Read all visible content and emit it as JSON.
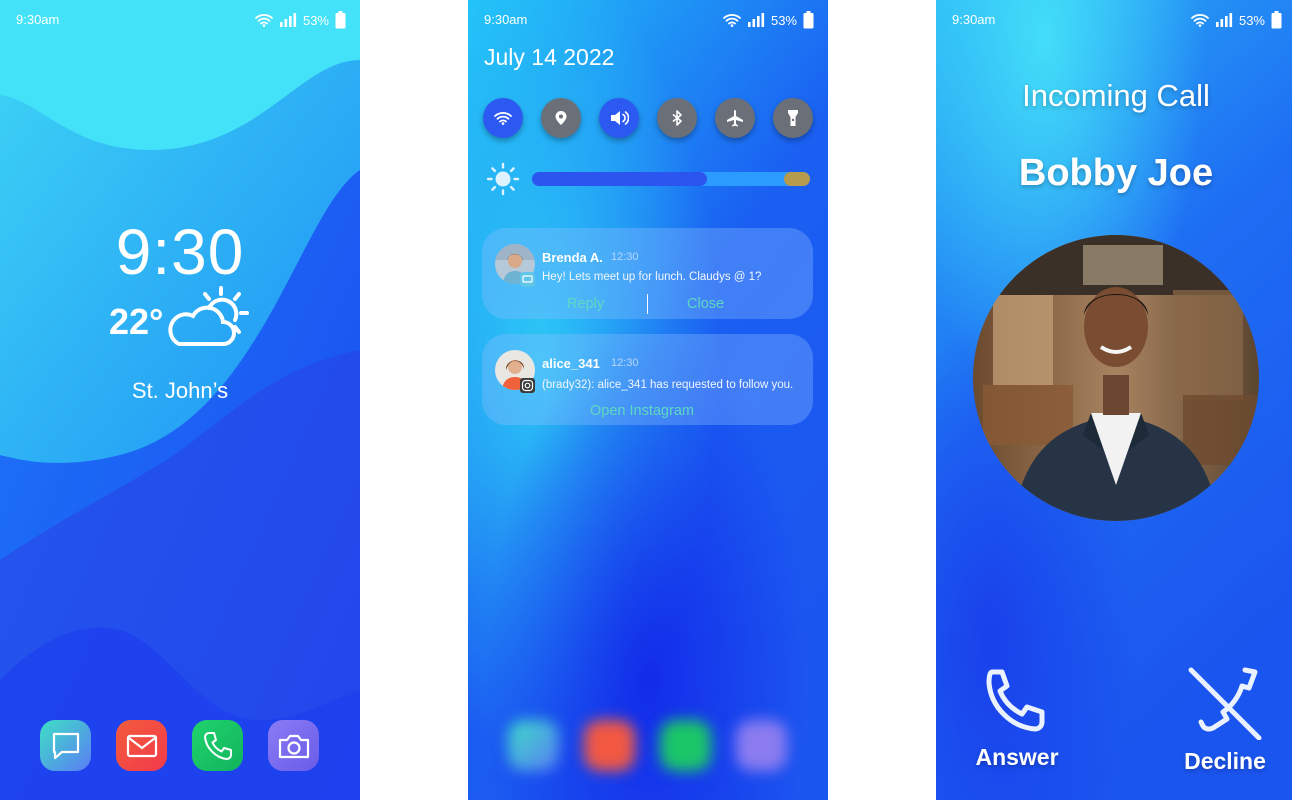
{
  "status_bar": {
    "time": "9:30am",
    "battery": "53%"
  },
  "lock_screen": {
    "clock": "9:30",
    "temperature": "22°",
    "weather_icon": "partly-sunny-icon",
    "city": "St. John’s",
    "dock": [
      {
        "name": "messages",
        "icon": "message-icon"
      },
      {
        "name": "email",
        "icon": "mail-icon"
      },
      {
        "name": "phone",
        "icon": "phone-icon"
      },
      {
        "name": "camera",
        "icon": "camera-icon"
      }
    ]
  },
  "notification_shade": {
    "date": "July 14 2022",
    "quick_settings": [
      {
        "name": "wifi",
        "icon": "wifi-icon",
        "on": true
      },
      {
        "name": "location",
        "icon": "location-pin-icon",
        "on": false
      },
      {
        "name": "sound",
        "icon": "volume-icon",
        "on": true
      },
      {
        "name": "bluetooth",
        "icon": "bluetooth-icon",
        "on": false
      },
      {
        "name": "airplane-mode",
        "icon": "airplane-icon",
        "on": false
      },
      {
        "name": "flashlight",
        "icon": "flashlight-icon",
        "on": false
      }
    ],
    "brightness": {
      "icon": "sun-icon",
      "level": 0.63
    },
    "notifications": [
      {
        "sender": "Brenda A.",
        "time": "12:30",
        "message": "Hey! Lets meet up for lunch. Claudys @ 1?",
        "app_icon": "messages-badge-icon",
        "actions": [
          "Reply",
          "Close"
        ]
      },
      {
        "sender": "alice_341",
        "time": "12:30",
        "message": "(brady32): alice_341 has requested to follow you.",
        "app_icon": "instagram-badge-icon",
        "actions": [
          "Open Instagram"
        ]
      }
    ]
  },
  "incoming_call": {
    "title": "Incoming Call",
    "caller": "Bobby Joe",
    "answer_label": "Answer",
    "decline_label": "Decline"
  }
}
